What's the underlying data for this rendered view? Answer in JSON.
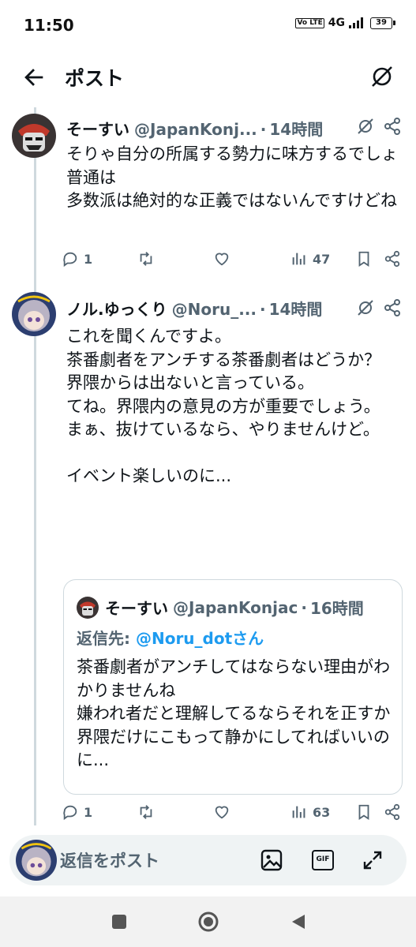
{
  "status_bar": {
    "time": "11:50",
    "network": "4G",
    "volte": "Vo LTE",
    "battery": "39"
  },
  "header": {
    "title": "ポスト"
  },
  "posts": [
    {
      "name": "そーすい",
      "handle": "@JapanKonj...",
      "dot": "·",
      "time": "14時間",
      "text": "そりゃ自分の所属する勢力に味方するでしょ普通は\n多数派は絶対的な正義ではないんですけどね",
      "replies": "1",
      "reposts": "",
      "likes": "",
      "views": "47"
    },
    {
      "name": "ノル.ゆっくり",
      "handle": "@Noru_...",
      "dot": "·",
      "time": "14時間",
      "text": "これを聞くんですよ。\n茶番劇者をアンチする茶番劇者はどうか？\n界隈からは出ないと言っている。\nてね。界隈内の意見の方が重要でしょう。\nまぁ、抜けているなら、やりませんけど。\n\nイベント楽しいのに...",
      "replies": "1",
      "reposts": "",
      "likes": "",
      "views": "63",
      "quote": {
        "name": "そーすい",
        "handle": "@JapanKonjac",
        "dot": "·",
        "time": "16時間",
        "reply_prefix": "返信先: ",
        "reply_to": "@Noru_dotさん",
        "text": "茶番劇者がアンチしてはならない理由がわかりませんね\n嫌われ者だと理解してるならそれを正すか界隈だけにこもって静かにしてればいいのに..."
      }
    }
  ],
  "reply_bar": {
    "placeholder": "返信をポスト",
    "gif_label": "GIF"
  },
  "icons": {
    "back": "arrow-left-icon",
    "grok": "grok-icon",
    "more": "share-icon",
    "reply": "reply-icon",
    "repost": "repost-icon",
    "like": "heart-icon",
    "views": "views-icon",
    "bookmark": "bookmark-icon",
    "share": "share-icon",
    "image": "image-icon",
    "gif": "gif-icon",
    "expand": "expand-icon"
  },
  "colors": {
    "text": "#0f1419",
    "secondary": "#536471",
    "link": "#1d9bf0",
    "border": "#cfd9de"
  }
}
